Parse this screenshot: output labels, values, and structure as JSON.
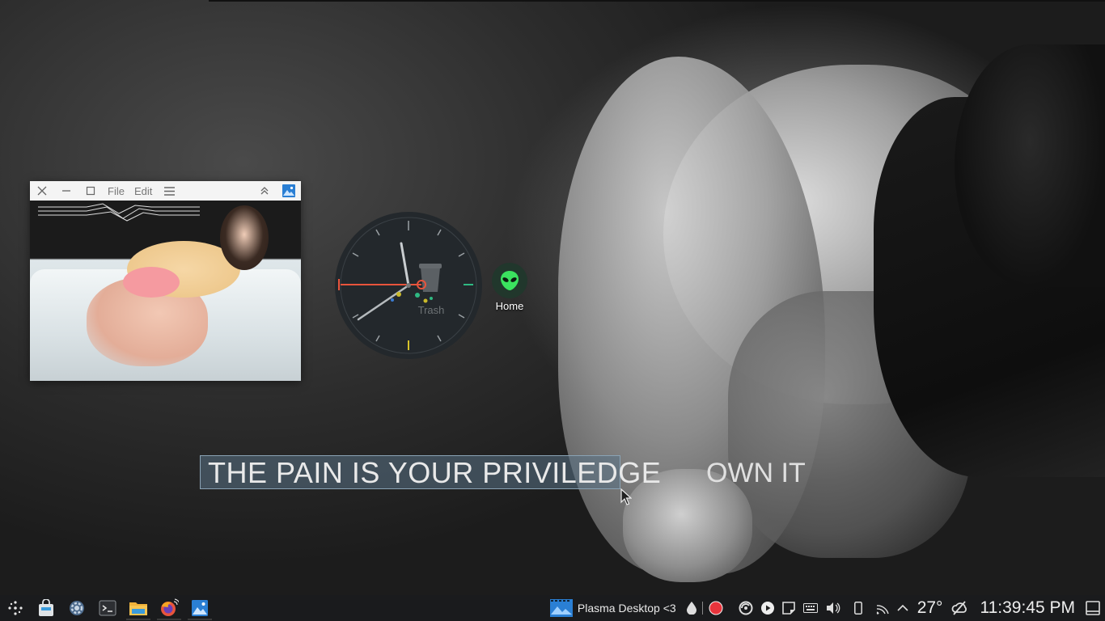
{
  "wallpaper": {
    "slogan_left": "THE PAIN IS YOUR PRIVILEDGE",
    "slogan_right": "OWN IT"
  },
  "viewer_window": {
    "menu": [
      "File",
      "Edit"
    ],
    "icons": [
      "close-icon",
      "minimize-icon",
      "maximize-icon",
      "hamburger-menu-icon",
      "keep-above-icon",
      "image-viewer-app-icon"
    ]
  },
  "desktop": {
    "trash_label": "Trash",
    "home_label": "Home"
  },
  "taskbar": {
    "launchers": [
      "application-launcher-icon",
      "discover-store-icon",
      "system-settings-icon",
      "konsole-terminal-icon",
      "file-manager-icon",
      "firefox-icon",
      "image-viewer-icon"
    ],
    "window_title": "Plasma Desktop <3",
    "tray": [
      "color-picker-icon",
      "record-icon",
      "software-updates-icon",
      "media-player-icon",
      "notes-icon",
      "keyboard-icon",
      "volume-icon",
      "phone-connect-icon",
      "network-icon",
      "tray-expand-icon"
    ],
    "temperature": "27°",
    "clock": "11:39:45 PM",
    "colors": {
      "record": "#e8343c",
      "taskbar_bg": "#1a1b1d"
    }
  }
}
